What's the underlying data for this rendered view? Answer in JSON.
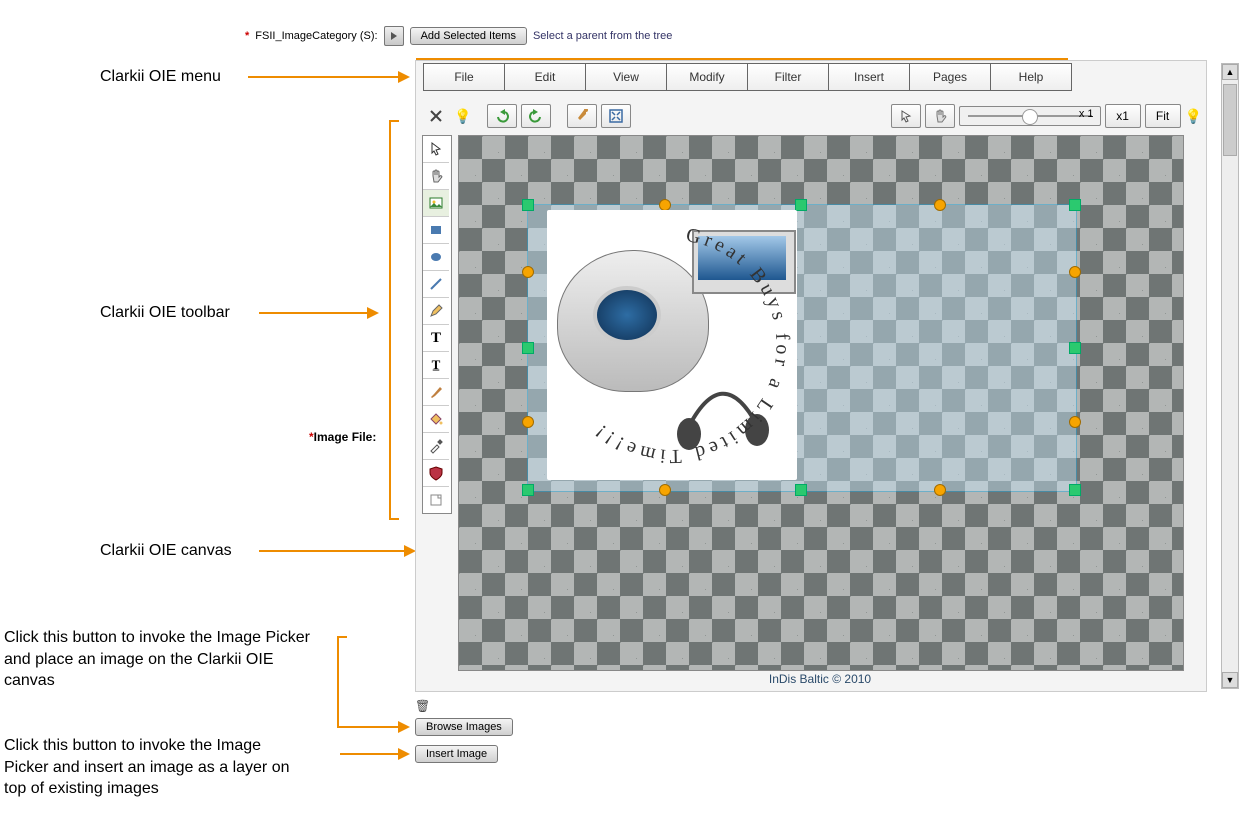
{
  "fsii": {
    "label": "FSII_ImageCategory (S):",
    "add_button": "Add Selected Items",
    "hint": "Select a parent from the tree"
  },
  "annotations": {
    "menu": "Clarkii OIE menu",
    "toolbar": "Clarkii OIE toolbar",
    "canvas": "Clarkii OIE canvas",
    "browse_desc": "Click this button to invoke the Image Picker and place an image on the Clarkii OIE canvas",
    "insert_desc": "Click this button to invoke the Image Picker and insert an image as a layer on top of existing images"
  },
  "menu": [
    "File",
    "Edit",
    "View",
    "Modify",
    "Filter",
    "Insert",
    "Pages",
    "Help"
  ],
  "zoom": {
    "value_label": "x 1",
    "btn_x1": "x1",
    "btn_fit": "Fit"
  },
  "image_file_label": "Image File:",
  "footer": "InDis Baltic © 2010",
  "buttons": {
    "browse": "Browse Images",
    "insert": "Insert Image"
  },
  "canvas_text": "Great Buys for a Limited Time!!!"
}
